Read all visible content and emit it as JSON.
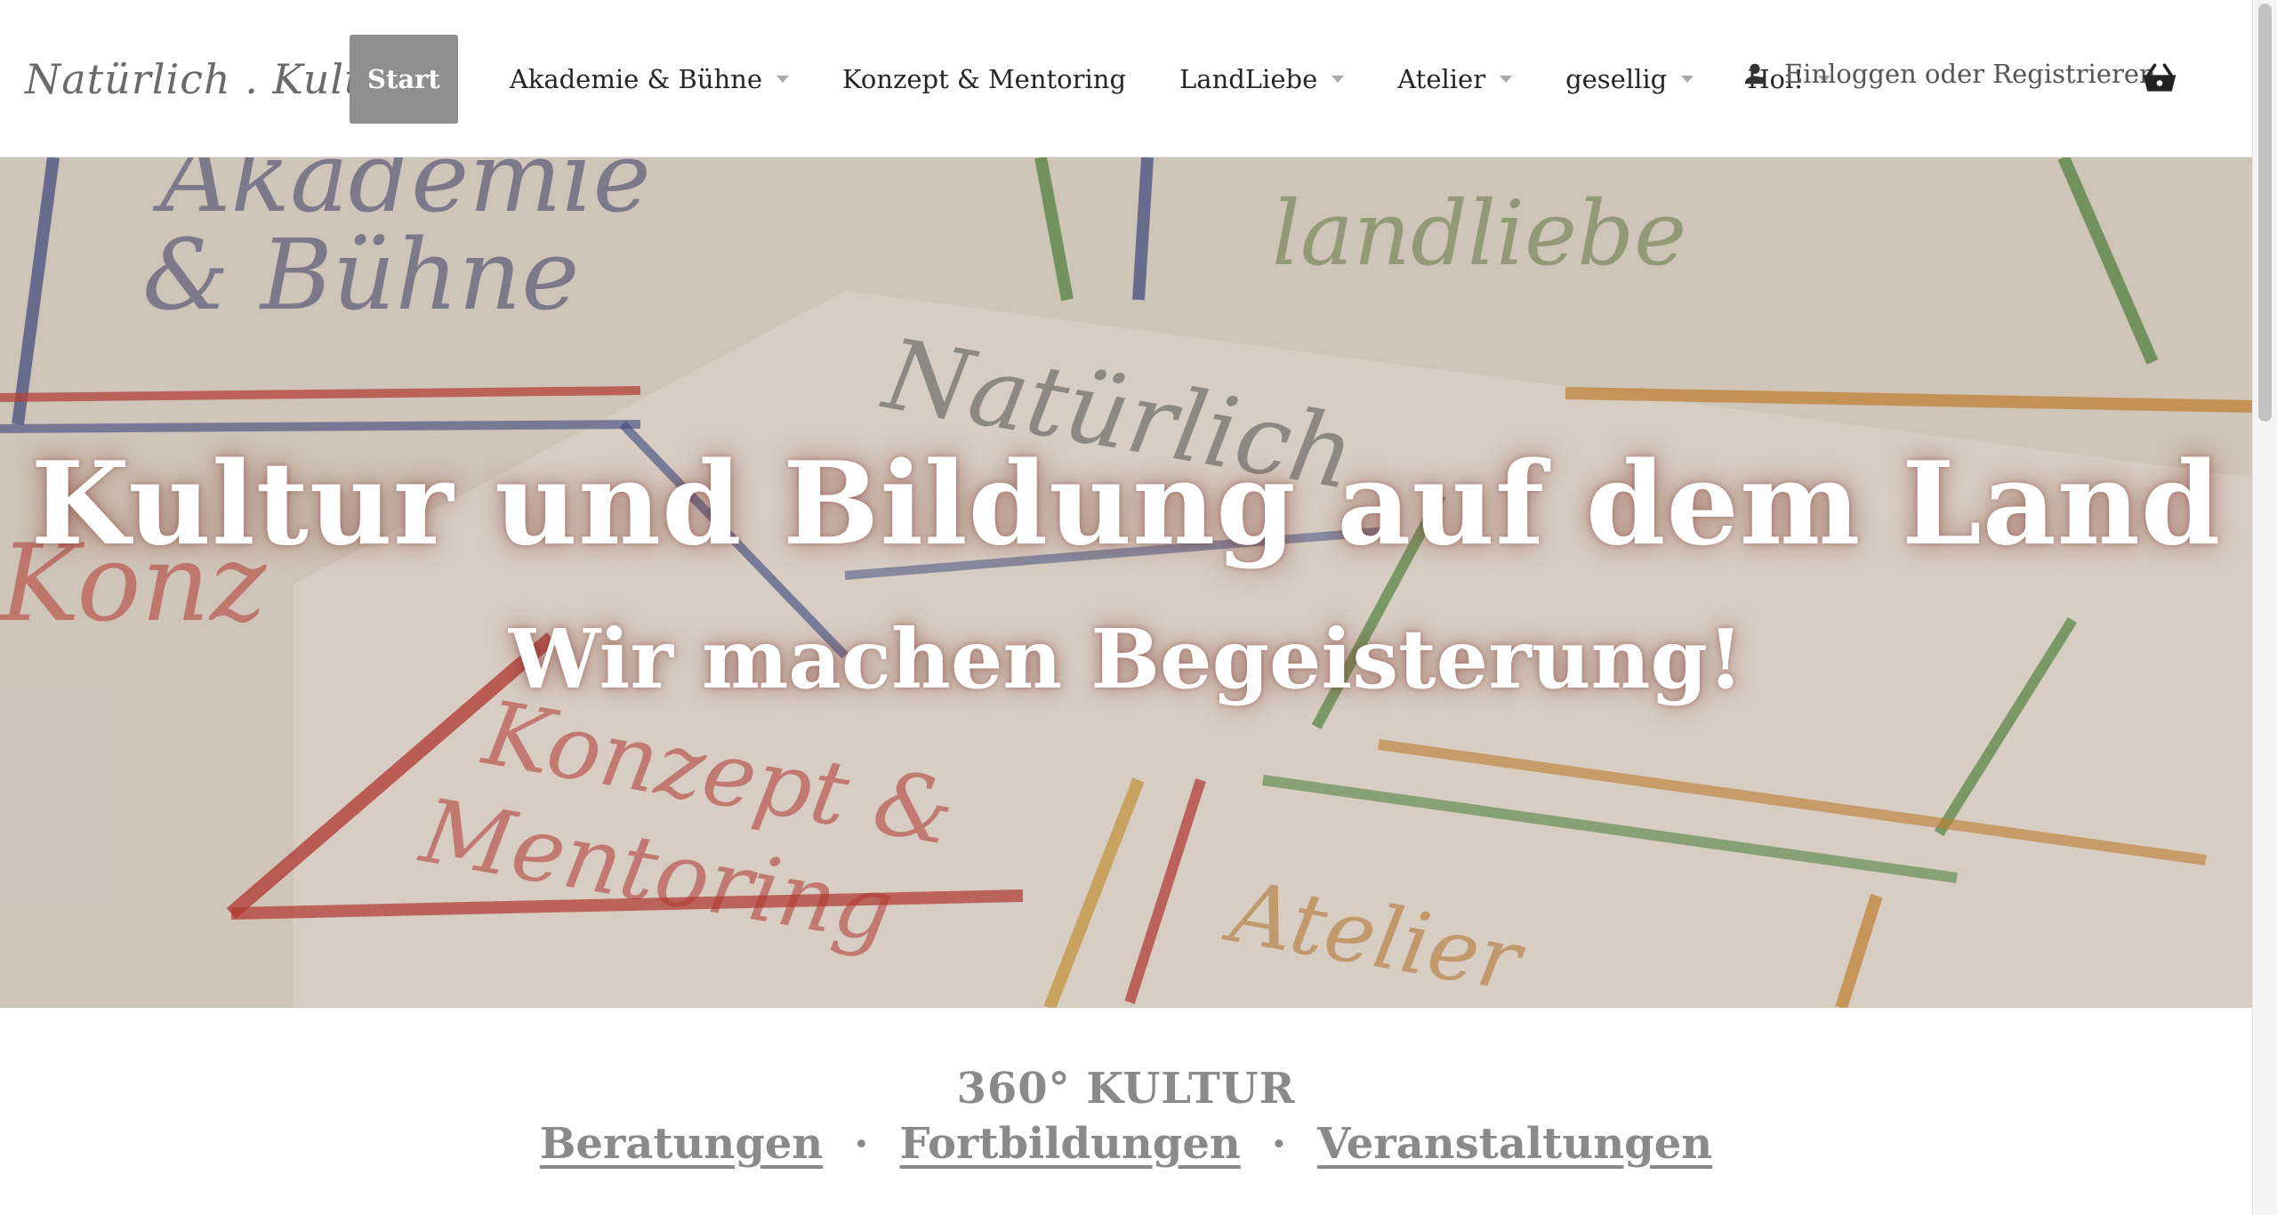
{
  "header": {
    "logo_text": "Natürlich . Kultur.",
    "nav": [
      {
        "label": "Start",
        "active": true,
        "dropdown": false
      },
      {
        "label": "Akademie & Bühne",
        "active": false,
        "dropdown": true
      },
      {
        "label": "Konzept & Mentoring",
        "active": false,
        "dropdown": false
      },
      {
        "label": "LandLiebe",
        "active": false,
        "dropdown": true
      },
      {
        "label": "Atelier",
        "active": false,
        "dropdown": true
      },
      {
        "label": "gesellig",
        "active": false,
        "dropdown": true
      },
      {
        "label": "Hoi!",
        "active": false,
        "dropdown": true
      }
    ],
    "login_label": "Einloggen oder Registrieren",
    "login_icon": "person-icon",
    "cart_icon": "basket-icon"
  },
  "hero": {
    "title": "Kultur und Bildung auf dem Land",
    "subtitle": "Wir machen Begeisterung!"
  },
  "section": {
    "heading": "360° KULTUR",
    "links": [
      "Beratungen",
      "Fortbildungen",
      "Veranstaltungen"
    ],
    "separator": "·"
  },
  "colors": {
    "active_nav_bg": "#8f8f8f",
    "link_gray": "#8a8a8a",
    "hero_text": "#ffffff"
  }
}
